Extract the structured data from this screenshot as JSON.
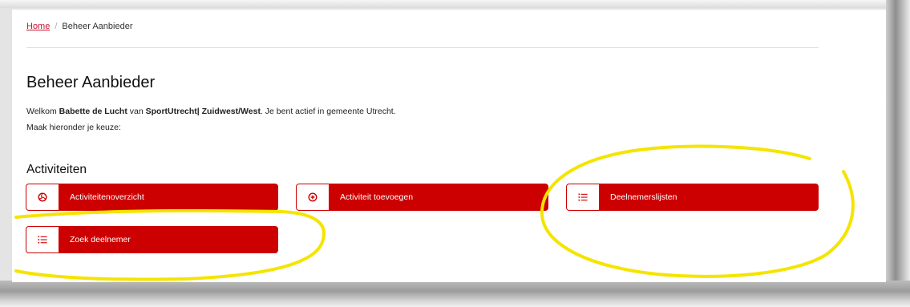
{
  "breadcrumb": {
    "home_label": "Home",
    "separator": "/",
    "current_label": "Beheer Aanbieder"
  },
  "page": {
    "title": "Beheer Aanbieder"
  },
  "welcome": {
    "prefix": "Welkom ",
    "user_name": "Babette de Lucht",
    "mid": " van ",
    "organization": "SportUtrecht| Zuidwest/West",
    "suffix": ". Je bent actief in gemeente Utrecht."
  },
  "instruction": "Maak hieronder je keuze:",
  "activities": {
    "title": "Activiteiten",
    "buttons": [
      {
        "label": "Activiteitenoverzicht",
        "icon": "volleyball-icon"
      },
      {
        "label": "Activiteit toevoegen",
        "icon": "plus-circle-icon"
      },
      {
        "label": "Deelnemerslijsten",
        "icon": "list-icon"
      },
      {
        "label": "Zoek deelnemer",
        "icon": "list-icon"
      }
    ]
  },
  "colors": {
    "brand_red": "#cc0000",
    "link_red": "#c8102e",
    "annotation_yellow": "#f5e400"
  }
}
